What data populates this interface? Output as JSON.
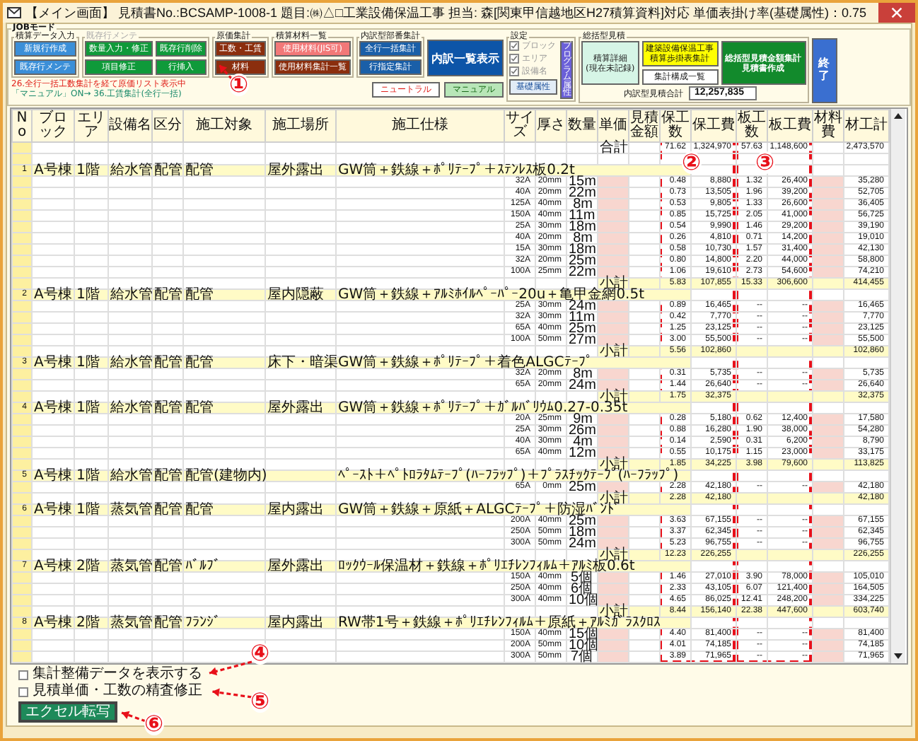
{
  "window": {
    "title": "【メイン画面】 見積書No.:BCSAMP-1008-1 題目:㈱△□工業設備保温工事 担当: 森[関東甲信越地区H27積算資料]対応 単価表掛け率(基礎属性)：0.75"
  },
  "job_mode": {
    "label": "JOBモード",
    "groups": [
      {
        "label": "積算データ入力",
        "disabled": false,
        "buttons": [
          {
            "label": "新規行作成",
            "kind": "blue"
          },
          {
            "label": "既存行メンテ",
            "kind": "blue"
          }
        ]
      },
      {
        "label": "既存行メンテ",
        "disabled": true,
        "buttons": [
          {
            "label": "数量入力・修正",
            "kind": "green"
          },
          {
            "label": "既存行削除",
            "kind": "green"
          },
          {
            "label": "項目修正",
            "kind": "green"
          },
          {
            "label": "行挿入",
            "kind": "green"
          }
        ]
      },
      {
        "label": "原価集計",
        "disabled": false,
        "buttons": [
          {
            "label": "工数・工賃",
            "kind": "brown"
          },
          {
            "label": "材料",
            "kind": "brown"
          }
        ]
      },
      {
        "label": "積算材料一覧",
        "disabled": false,
        "buttons": [
          {
            "label": "使用材料(JIS可)",
            "kind": "pink"
          },
          {
            "label": "使用材料集計一覧",
            "kind": "brown"
          }
        ]
      },
      {
        "label": "内訳型部番集計",
        "disabled": false,
        "buttons": [
          {
            "label": "全行一括集計",
            "kind": "navy"
          },
          {
            "label": "行指定集計",
            "kind": "navy"
          }
        ]
      }
    ],
    "list_button": {
      "label": "内訳一覧表示",
      "kind": "bigblue"
    },
    "notes": [
      {
        "text": "26.全行一括工数集計を経て原価リスト表示中",
        "kind": "alert"
      },
      {
        "text": "「マニュアル」ON→ 36.工賃集計(全行一括)",
        "kind": "info"
      }
    ],
    "mode_buttons": [
      {
        "label": "ニュートラル",
        "kind": "neutral"
      },
      {
        "label": "マニュアル",
        "kind": "manual"
      }
    ],
    "settings": {
      "label": "設定",
      "options": [
        {
          "label": "ブロック",
          "checked": true,
          "disabled": true
        },
        {
          "label": "エリア",
          "checked": true,
          "disabled": true
        },
        {
          "label": "設備名",
          "checked": true,
          "disabled": true
        }
      ],
      "program_button": {
        "label": "プログラム属性",
        "kind": "purple"
      },
      "basic_button": {
        "label": "基礎属性",
        "kind": "light"
      }
    },
    "summary": {
      "label": "総括型見積",
      "buttons": [
        {
          "lines": [
            "積算詳細",
            "(現在未記録)"
          ],
          "kind": "mint"
        },
        {
          "lines": [
            "建築設備保温工事",
            "積算歩掛表集計"
          ],
          "kind": "yellow"
        },
        {
          "lines": [
            "集計構成一覧"
          ],
          "kind": "white"
        },
        {
          "lines": [
            "総括型見積金額集計",
            "見積書作成"
          ],
          "kind": "darkgreen"
        }
      ],
      "total_field": {
        "label": "内訳型見積合計",
        "value": "12,257,835"
      }
    },
    "exit_button": {
      "label": "終了",
      "kind": "exit"
    }
  },
  "table": {
    "columns": [
      "No",
      "ブロック",
      "エリア",
      "設備名",
      "区分",
      "施工対象",
      "施工場所",
      "施工仕様",
      "サイズ",
      "厚さ",
      "数量",
      "単価",
      "見積金額",
      "保工数",
      "保工費",
      "板工数",
      "板工費",
      "材料費",
      "材工計"
    ],
    "total": {
      "label": "合計",
      "labor_hours": "71.62",
      "labor_cost": "1,324,970",
      "sheet_hours": "57.63",
      "sheet_cost": "1,148,600",
      "total": "2,473,570"
    },
    "groups": [
      {
        "no": "1",
        "block": "A号棟",
        "area": "1階",
        "equipment": "給水管",
        "category": "配管",
        "target": "配管",
        "place": "屋外露出",
        "spec": "GW筒＋鉄線＋ﾎﾟﾘﾃｰﾌﾟ＋ｽﾃﾝﾚｽ板0.2t",
        "items": [
          {
            "size": "32A",
            "thickness": "20mm",
            "qty": "15m",
            "labor_hours": "0.48",
            "labor_cost": "8,880",
            "sheet_hours": "1.32",
            "sheet_cost": "26,400",
            "total": "35,280"
          },
          {
            "size": "40A",
            "thickness": "20mm",
            "qty": "22m",
            "labor_hours": "0.73",
            "labor_cost": "13,505",
            "sheet_hours": "1.96",
            "sheet_cost": "39,200",
            "total": "52,705"
          },
          {
            "size": "125A",
            "thickness": "40mm",
            "qty": "8m",
            "labor_hours": "0.53",
            "labor_cost": "9,805",
            "sheet_hours": "1.33",
            "sheet_cost": "26,600",
            "total": "36,405"
          },
          {
            "size": "150A",
            "thickness": "40mm",
            "qty": "11m",
            "labor_hours": "0.85",
            "labor_cost": "15,725",
            "sheet_hours": "2.05",
            "sheet_cost": "41,000",
            "total": "56,725"
          },
          {
            "size": "25A",
            "thickness": "30mm",
            "qty": "18m",
            "labor_hours": "0.54",
            "labor_cost": "9,990",
            "sheet_hours": "1.46",
            "sheet_cost": "29,200",
            "total": "39,190"
          },
          {
            "size": "40A",
            "thickness": "20mm",
            "qty": "8m",
            "labor_hours": "0.26",
            "labor_cost": "4,810",
            "sheet_hours": "0.71",
            "sheet_cost": "14,200",
            "total": "19,010"
          },
          {
            "size": "15A",
            "thickness": "30mm",
            "qty": "18m",
            "labor_hours": "0.58",
            "labor_cost": "10,730",
            "sheet_hours": "1.57",
            "sheet_cost": "31,400",
            "total": "42,130"
          },
          {
            "size": "32A",
            "thickness": "20mm",
            "qty": "25m",
            "labor_hours": "0.80",
            "labor_cost": "14,800",
            "sheet_hours": "2.20",
            "sheet_cost": "44,000",
            "total": "58,800"
          },
          {
            "size": "100A",
            "thickness": "25mm",
            "qty": "22m",
            "labor_hours": "1.06",
            "labor_cost": "19,610",
            "sheet_hours": "2.73",
            "sheet_cost": "54,600",
            "total": "74,210"
          }
        ],
        "subtotal": {
          "label": "小計",
          "labor_hours": "5.83",
          "labor_cost": "107,855",
          "sheet_hours": "15.33",
          "sheet_cost": "306,600",
          "total": "414,455"
        }
      },
      {
        "no": "2",
        "block": "A号棟",
        "area": "1階",
        "equipment": "給水管",
        "category": "配管",
        "target": "配管",
        "place": "屋内隠蔽",
        "spec": "GW筒＋鉄線＋ｱﾙﾐﾎｲﾙﾍﾟｰﾊﾟｰ20u＋亀甲金網0.5t",
        "items": [
          {
            "size": "25A",
            "thickness": "30mm",
            "qty": "24m",
            "labor_hours": "0.89",
            "labor_cost": "16,465",
            "sheet_hours": "--",
            "sheet_cost": "--",
            "total": "16,465"
          },
          {
            "size": "32A",
            "thickness": "30mm",
            "qty": "11m",
            "labor_hours": "0.42",
            "labor_cost": "7,770",
            "sheet_hours": "--",
            "sheet_cost": "--",
            "total": "7,770"
          },
          {
            "size": "65A",
            "thickness": "40mm",
            "qty": "25m",
            "labor_hours": "1.25",
            "labor_cost": "23,125",
            "sheet_hours": "--",
            "sheet_cost": "--",
            "total": "23,125"
          },
          {
            "size": "100A",
            "thickness": "50mm",
            "qty": "27m",
            "labor_hours": "3.00",
            "labor_cost": "55,500",
            "sheet_hours": "--",
            "sheet_cost": "--",
            "total": "55,500"
          }
        ],
        "subtotal": {
          "label": "小計",
          "labor_hours": "5.56",
          "labor_cost": "102,860",
          "total": "102,860"
        }
      },
      {
        "no": "3",
        "block": "A号棟",
        "area": "1階",
        "equipment": "給水管",
        "category": "配管",
        "target": "配管",
        "place": "床下・暗渠",
        "spec": "GW筒＋鉄線＋ﾎﾟﾘﾃｰﾌﾟ＋着色ALGCﾃｰﾌﾟ",
        "items": [
          {
            "size": "32A",
            "thickness": "20mm",
            "qty": "8m",
            "labor_hours": "0.31",
            "labor_cost": "5,735",
            "sheet_hours": "--",
            "sheet_cost": "--",
            "total": "5,735"
          },
          {
            "size": "65A",
            "thickness": "20mm",
            "qty": "24m",
            "labor_hours": "1.44",
            "labor_cost": "26,640",
            "sheet_hours": "--",
            "sheet_cost": "--",
            "total": "26,640"
          }
        ],
        "subtotal": {
          "label": "小計",
          "labor_hours": "1.75",
          "labor_cost": "32,375",
          "total": "32,375"
        }
      },
      {
        "no": "4",
        "block": "A号棟",
        "area": "1階",
        "equipment": "給水管",
        "category": "配管",
        "target": "配管",
        "place": "屋外露出",
        "spec": "GW筒＋鉄線＋ﾎﾟﾘﾃｰﾌﾟ＋ｶﾞﾙﾊﾞﾘｳﾑ0.27-0.35t",
        "items": [
          {
            "size": "20A",
            "thickness": "25mm",
            "qty": "9m",
            "labor_hours": "0.28",
            "labor_cost": "5,180",
            "sheet_hours": "0.62",
            "sheet_cost": "12,400",
            "total": "17,580"
          },
          {
            "size": "25A",
            "thickness": "30mm",
            "qty": "26m",
            "labor_hours": "0.88",
            "labor_cost": "16,280",
            "sheet_hours": "1.90",
            "sheet_cost": "38,000",
            "total": "54,280"
          },
          {
            "size": "40A",
            "thickness": "30mm",
            "qty": "4m",
            "labor_hours": "0.14",
            "labor_cost": "2,590",
            "sheet_hours": "0.31",
            "sheet_cost": "6,200",
            "total": "8,790"
          },
          {
            "size": "65A",
            "thickness": "40mm",
            "qty": "12m",
            "labor_hours": "0.55",
            "labor_cost": "10,175",
            "sheet_hours": "1.15",
            "sheet_cost": "23,000",
            "total": "33,175"
          }
        ],
        "subtotal": {
          "label": "小計",
          "labor_hours": "1.85",
          "labor_cost": "34,225",
          "sheet_hours": "3.98",
          "sheet_cost": "79,600",
          "total": "113,825"
        }
      },
      {
        "no": "5",
        "block": "A号棟",
        "area": "1階",
        "equipment": "給水管",
        "category": "配管",
        "target": "配管(建物内)",
        "spec": "ﾍﾟｰｽﾄ＋ﾍﾟﾄﾛﾗﾀﾑﾃｰﾌﾟ(ﾊｰﾌﾗｯﾌﾟ)＋ﾌﾟﾗｽﾁｯｸﾃｰﾌﾟ(ﾊｰﾌﾗｯﾌﾟ)",
        "items": [
          {
            "size": "65A",
            "thickness": "0mm",
            "qty": "25m",
            "labor_hours": "2.28",
            "labor_cost": "42,180",
            "sheet_hours": "--",
            "sheet_cost": "--",
            "total": "42,180"
          }
        ],
        "subtotal": {
          "label": "小計",
          "labor_hours": "2.28",
          "labor_cost": "42,180",
          "total": "42,180"
        }
      },
      {
        "no": "6",
        "block": "A号棟",
        "area": "1階",
        "equipment": "蒸気管",
        "category": "配管",
        "target": "配管",
        "place": "屋内露出",
        "spec": "GW筒＋鉄線＋原紙＋ALGCﾃｰﾌﾟ＋防湿ﾊﾞﾝﾄﾞ",
        "items": [
          {
            "size": "200A",
            "thickness": "40mm",
            "qty": "25m",
            "labor_hours": "3.63",
            "labor_cost": "67,155",
            "sheet_hours": "--",
            "sheet_cost": "--",
            "total": "67,155"
          },
          {
            "size": "250A",
            "thickness": "50mm",
            "qty": "18m",
            "labor_hours": "3.37",
            "labor_cost": "62,345",
            "sheet_hours": "--",
            "sheet_cost": "--",
            "total": "62,345"
          },
          {
            "size": "300A",
            "thickness": "50mm",
            "qty": "24m",
            "labor_hours": "5.23",
            "labor_cost": "96,755",
            "sheet_hours": "--",
            "sheet_cost": "--",
            "total": "96,755"
          }
        ],
        "subtotal": {
          "label": "小計",
          "labor_hours": "12.23",
          "labor_cost": "226,255",
          "total": "226,255"
        }
      },
      {
        "no": "7",
        "block": "A号棟",
        "area": "2階",
        "equipment": "蒸気管",
        "category": "配管",
        "target": "ﾊﾞﾙﾌﾞ",
        "place": "屋外露出",
        "spec": "ﾛｯｸｳｰﾙ保温材＋鉄線＋ﾎﾟﾘｴﾁﾚﾝﾌｨﾙﾑ＋ｱﾙﾐ板0.6t",
        "items": [
          {
            "size": "150A",
            "thickness": "40mm",
            "qty": "5個",
            "labor_hours": "1.46",
            "labor_cost": "27,010",
            "sheet_hours": "3.90",
            "sheet_cost": "78,000",
            "total": "105,010"
          },
          {
            "size": "250A",
            "thickness": "40mm",
            "qty": "6個",
            "labor_hours": "2.33",
            "labor_cost": "43,105",
            "sheet_hours": "6.07",
            "sheet_cost": "121,400",
            "total": "164,505"
          },
          {
            "size": "300A",
            "thickness": "40mm",
            "qty": "10個",
            "labor_hours": "4.65",
            "labor_cost": "86,025",
            "sheet_hours": "12.41",
            "sheet_cost": "248,200",
            "total": "334,225"
          }
        ],
        "subtotal": {
          "label": "小計",
          "labor_hours": "8.44",
          "labor_cost": "156,140",
          "sheet_hours": "22.38",
          "sheet_cost": "447,600",
          "total": "603,740"
        }
      },
      {
        "no": "8",
        "block": "A号棟",
        "area": "2階",
        "equipment": "蒸気管",
        "category": "配管",
        "target": "ﾌﾗﾝｼﾞ",
        "place": "屋内露出",
        "spec": "RW帯1号＋鉄線＋ﾎﾟﾘｴﾁﾚﾝﾌｨﾙﾑ＋原紙＋ｱﾙﾐｶﾞﾗｽｸﾛｽ",
        "items": [
          {
            "size": "150A",
            "thickness": "40mm",
            "qty": "15個",
            "labor_hours": "4.40",
            "labor_cost": "81,400",
            "sheet_hours": "--",
            "sheet_cost": "--",
            "total": "81,400"
          },
          {
            "size": "200A",
            "thickness": "50mm",
            "qty": "10個",
            "labor_hours": "4.01",
            "labor_cost": "74,185",
            "sheet_hours": "--",
            "sheet_cost": "--",
            "total": "74,185"
          },
          {
            "size": "300A",
            "thickness": "50mm",
            "qty": "7個",
            "labor_hours": "3.89",
            "labor_cost": "71,965",
            "sheet_hours": "--",
            "sheet_cost": "--",
            "total": "71,965"
          }
        ]
      }
    ]
  },
  "options": [
    {
      "label": "集計整備データを表示する",
      "checked": false
    },
    {
      "label": "見積単価・工数の精査修正",
      "checked": false
    }
  ],
  "excel_button": {
    "label": "エクセル転写",
    "kind": "excel"
  },
  "annotations": [
    {
      "label": "①"
    },
    {
      "label": "②"
    },
    {
      "label": "③"
    },
    {
      "label": "④"
    },
    {
      "label": "⑤"
    },
    {
      "label": "⑥"
    }
  ]
}
